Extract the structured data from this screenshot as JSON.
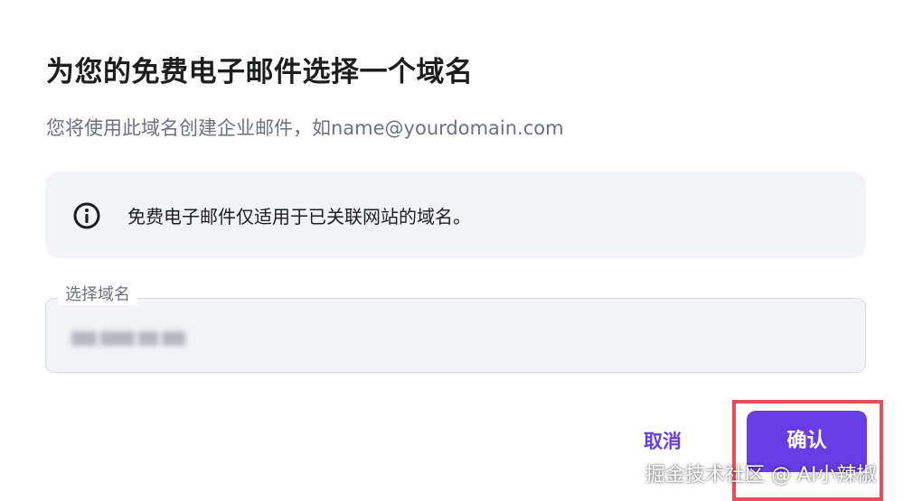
{
  "dialog": {
    "title": "为您的免费电子邮件选择一个域名",
    "subtitle": "您将使用此域名创建企业邮件，如name@yourdomain.com"
  },
  "info": {
    "icon": "info-circle-icon",
    "text": "免费电子邮件仅适用于已关联网站的域名。"
  },
  "domain_field": {
    "label": "选择域名",
    "value_state": "blurred"
  },
  "actions": {
    "cancel_label": "取消",
    "confirm_label": "确认"
  },
  "watermark": "掘金技术社区 @ AI小辣椒",
  "colors": {
    "accent": "#673de6",
    "highlight": "#ec4b5a",
    "info_bg": "#f2f3f6"
  }
}
